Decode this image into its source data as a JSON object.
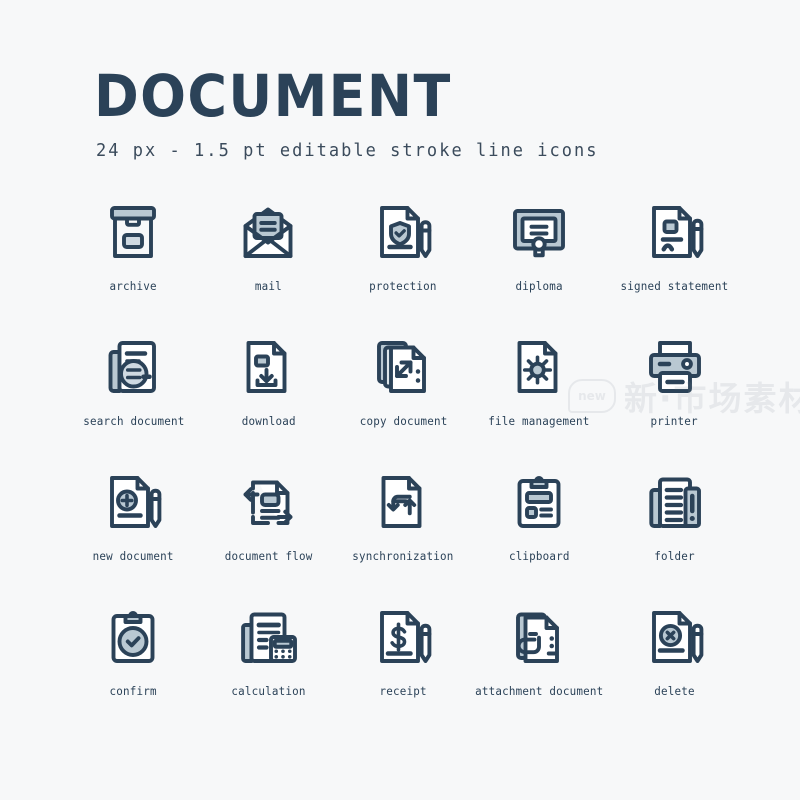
{
  "page": {
    "background_color": "#f7f8f9",
    "stroke_color": "#2b4258",
    "fill_color": "#b9c8d2",
    "paper_color": "#ffffff"
  },
  "header": {
    "title": "DOCUMENT",
    "subtitle": "24 px - 1.5 pt editable stroke line icons"
  },
  "watermark": {
    "badge": "new",
    "text": "新·市场素材"
  },
  "icons": [
    {
      "label": "archive",
      "icon_name": "archive-box-icon"
    },
    {
      "label": "mail",
      "icon_name": "open-envelope-icon"
    },
    {
      "label": "protection",
      "icon_name": "document-shield-check-pen-icon"
    },
    {
      "label": "diploma",
      "icon_name": "framed-certificate-seal-icon"
    },
    {
      "label": "signed statement",
      "icon_name": "document-signature-pen-icon"
    },
    {
      "label": "search document",
      "icon_name": "document-magnifier-icon"
    },
    {
      "label": "download",
      "icon_name": "document-download-arrow-icon"
    },
    {
      "label": "copy document",
      "icon_name": "copy-documents-arrows-icon"
    },
    {
      "label": "file management",
      "icon_name": "document-gear-icon"
    },
    {
      "label": "printer",
      "icon_name": "printer-icon"
    },
    {
      "label": "new document",
      "icon_name": "document-plus-pen-icon"
    },
    {
      "label": "document flow",
      "icon_name": "document-flow-arrows-icon"
    },
    {
      "label": "synchronization",
      "icon_name": "document-sync-arrows-icon"
    },
    {
      "label": "clipboard",
      "icon_name": "clipboard-list-icon"
    },
    {
      "label": "folder",
      "icon_name": "folder-pages-exclamation-icon"
    },
    {
      "label": "confirm",
      "icon_name": "clipboard-check-icon"
    },
    {
      "label": "calculation",
      "icon_name": "document-calculator-icon"
    },
    {
      "label": "receipt",
      "icon_name": "document-dollar-pen-icon"
    },
    {
      "label": "attachment document",
      "icon_name": "documents-paperclip-icon"
    },
    {
      "label": "delete",
      "icon_name": "document-delete-pen-icon"
    }
  ]
}
